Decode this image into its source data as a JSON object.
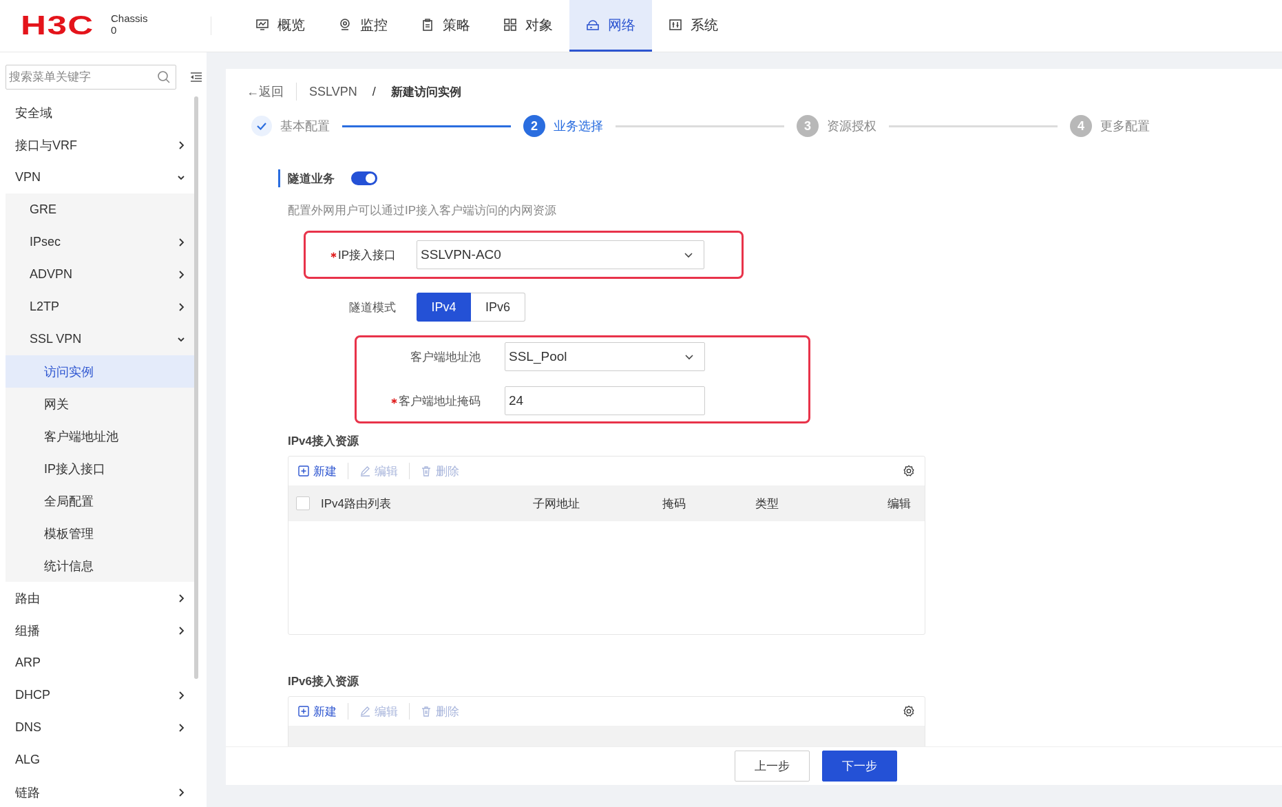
{
  "header": {
    "logo": "H3C",
    "device": "Chassis",
    "device_sub": "0",
    "nav": [
      {
        "label": "概览",
        "selected": false
      },
      {
        "label": "监控",
        "selected": false
      },
      {
        "label": "策略",
        "selected": false
      },
      {
        "label": "对象",
        "selected": false
      },
      {
        "label": "网络",
        "selected": true
      },
      {
        "label": "系统",
        "selected": false
      }
    ]
  },
  "sidebar": {
    "search": {
      "placeholder": "搜索菜单关键字"
    },
    "items": [
      {
        "label": "安全域",
        "selected": false
      },
      {
        "label": "接口与VRF",
        "expanded": false,
        "selected": false
      },
      {
        "label": "VPN",
        "expanded": true,
        "selected": false,
        "children": [
          {
            "label": "GRE",
            "selected": false
          },
          {
            "label": "IPsec",
            "expanded": false,
            "selected": false
          },
          {
            "label": "ADVPN",
            "expanded": false,
            "selected": false
          },
          {
            "label": "L2TP",
            "expanded": false,
            "selected": false
          },
          {
            "label": "SSL VPN",
            "expanded": true,
            "selected": false,
            "children": [
              {
                "label": "访问实例",
                "selected": true
              },
              {
                "label": "网关",
                "selected": false
              },
              {
                "label": "客户端地址池",
                "selected": false
              },
              {
                "label": "IP接入接口",
                "selected": false
              },
              {
                "label": "全局配置",
                "selected": false
              },
              {
                "label": "模板管理",
                "selected": false
              },
              {
                "label": "统计信息",
                "selected": false
              }
            ]
          }
        ]
      },
      {
        "label": "路由",
        "expanded": false,
        "selected": false
      },
      {
        "label": "组播",
        "expanded": false,
        "selected": false
      },
      {
        "label": "ARP",
        "selected": false
      },
      {
        "label": "DHCP",
        "expanded": false,
        "selected": false
      },
      {
        "label": "DNS",
        "expanded": false,
        "selected": false
      },
      {
        "label": "ALG",
        "selected": false
      },
      {
        "label": "链路",
        "expanded": false,
        "selected": false
      }
    ]
  },
  "breadcrumb": {
    "back": "←返回",
    "items": [
      "SSLVPN",
      "新建访问实例"
    ],
    "separator": "/"
  },
  "steps": [
    {
      "label": "基本配置",
      "completed": true,
      "selected": false
    },
    {
      "number": "2",
      "label": "业务选择",
      "completed": false,
      "selected": true
    },
    {
      "number": "3",
      "label": "资源授权",
      "completed": false,
      "selected": false
    },
    {
      "number": "4",
      "label": "更多配置",
      "completed": false,
      "selected": false
    }
  ],
  "section": {
    "title": "隧道业务",
    "enabled": true,
    "description": "配置外网用户可以通过IP接入客户端访问的内网资源"
  },
  "form_groups": [
    {
      "highlighted": true,
      "nested": false,
      "fields": [
        {
          "kind": "select",
          "label": "IP接入接口",
          "required": true,
          "value": "SSLVPN-AC0"
        }
      ]
    },
    {
      "highlighted": false,
      "nested": false,
      "fields": [
        {
          "kind": "segmented",
          "label": "隧道模式",
          "required": false,
          "options": [
            {
              "label": "IPv4",
              "selected": true
            },
            {
              "label": "IPv6",
              "selected": false
            }
          ]
        }
      ]
    },
    {
      "highlighted": true,
      "nested": true,
      "fields": [
        {
          "kind": "select",
          "label": "客户端地址池",
          "required": false,
          "value": "SSL_Pool"
        },
        {
          "kind": "input",
          "label": "客户端地址掩码",
          "required": true,
          "value": "24"
        }
      ]
    }
  ],
  "tables": [
    {
      "title": "IPv4接入资源",
      "toolbar": [
        {
          "label": "新建",
          "disabled": false
        },
        {
          "label": "编辑",
          "disabled": true
        },
        {
          "label": "删除",
          "disabled": true
        }
      ],
      "select_all_checked": false,
      "columns": [
        "IPv4路由列表",
        "子网地址",
        "掩码",
        "类型",
        "编辑"
      ]
    },
    {
      "title": "IPv6接入资源",
      "toolbar": [
        {
          "label": "新建",
          "disabled": false
        },
        {
          "label": "编辑",
          "disabled": true
        },
        {
          "label": "删除",
          "disabled": true
        }
      ]
    }
  ],
  "footer": {
    "buttons": [
      {
        "label": "上一步",
        "kind": "default"
      },
      {
        "label": "下一步",
        "kind": "primary"
      }
    ]
  }
}
